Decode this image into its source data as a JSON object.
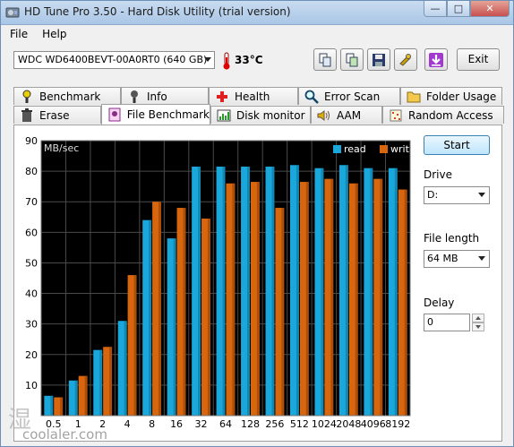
{
  "window": {
    "title": "HD Tune Pro 3.50 - Hard Disk Utility (trial version)"
  },
  "menu": [
    {
      "label": "File"
    },
    {
      "label": "Help"
    }
  ],
  "toolbar": {
    "drive": "WDC WD6400BEVT-00A0RT0 (640 GB)",
    "temperature": "33",
    "temperature_unit": "°C",
    "exit_label": "Exit",
    "buttons": [
      "copy-info-icon",
      "copy-screenshot-icon",
      "save-icon",
      "options-icon",
      "download-icon"
    ]
  },
  "tabs_top": [
    {
      "label": "Benchmark",
      "icon": "benchmark-icon"
    },
    {
      "label": "Info",
      "icon": "info-icon"
    },
    {
      "label": "Health",
      "icon": "health-icon"
    },
    {
      "label": "Error Scan",
      "icon": "error-scan-icon"
    },
    {
      "label": "Folder Usage",
      "icon": "folder-usage-icon"
    }
  ],
  "tabs_bottom": [
    {
      "label": "Erase",
      "icon": "erase-icon"
    },
    {
      "label": "File Benchmark",
      "icon": "file-benchmark-icon",
      "active": true
    },
    {
      "label": "Disk monitor",
      "icon": "disk-monitor-icon"
    },
    {
      "label": "AAM",
      "icon": "aam-icon"
    },
    {
      "label": "Random Access",
      "icon": "random-access-icon"
    }
  ],
  "side": {
    "start_label": "Start",
    "drive_label": "Drive",
    "drive_value": "D:",
    "file_length_label": "File length",
    "file_length_value": "64 MB",
    "delay_label": "Delay",
    "delay_value": "0"
  },
  "colors": {
    "read": "#1aa8dc",
    "write": "#d8660e",
    "plot_bg": "#000000",
    "grid": "#4a4a4a"
  },
  "chart_data": {
    "type": "bar",
    "ylabel": "MB/sec",
    "ylim": [
      0,
      90
    ],
    "yticks": [
      10,
      20,
      30,
      40,
      50,
      60,
      70,
      80,
      90
    ],
    "categories": [
      "0.5",
      "1",
      "2",
      "4",
      "8",
      "16",
      "32",
      "64",
      "128",
      "256",
      "512",
      "1024",
      "2048",
      "4096",
      "8192"
    ],
    "legend": "top-right",
    "grid": true,
    "series": [
      {
        "name": "read",
        "values": [
          6.5,
          11.5,
          21.5,
          31,
          64,
          58,
          81.5,
          81.5,
          81.5,
          81.5,
          82,
          81,
          82,
          81,
          81
        ]
      },
      {
        "name": "write",
        "values": [
          6,
          13,
          22.5,
          46,
          70,
          68,
          64.5,
          76,
          76.5,
          68,
          76.5,
          77.5,
          76,
          77.5,
          74
        ]
      }
    ]
  },
  "watermark": "coolaler.com"
}
